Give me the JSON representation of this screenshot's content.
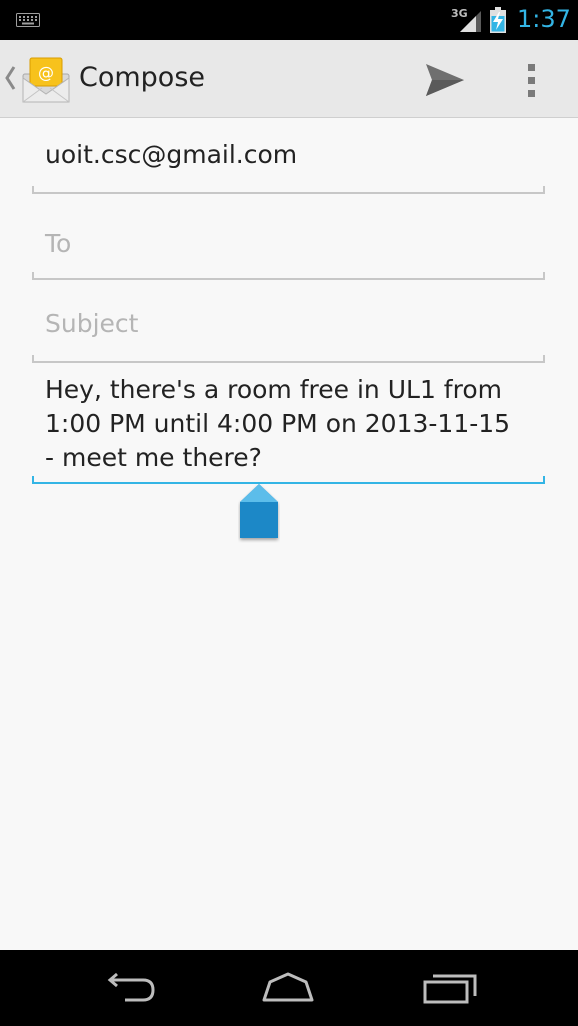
{
  "status_bar": {
    "network_type": "3G",
    "time": "1:37",
    "icons": [
      "keyboard-icon",
      "signal-icon",
      "battery-charging-icon"
    ],
    "accent_color": "#33b5e5"
  },
  "action_bar": {
    "title": "Compose",
    "icons": [
      "up-caret-icon",
      "email-app-icon",
      "send-icon",
      "overflow-menu-icon"
    ]
  },
  "compose": {
    "from": "uoit.csc@gmail.com",
    "to_placeholder": "To",
    "subject_placeholder": "Subject",
    "body": "Hey, there's a room free in UL1 from\n1:00 PM until 4:00 PM on 2013-11-15\n- meet me there?"
  },
  "nav_bar": {
    "icons": [
      "back-icon",
      "home-icon",
      "recents-icon"
    ]
  }
}
